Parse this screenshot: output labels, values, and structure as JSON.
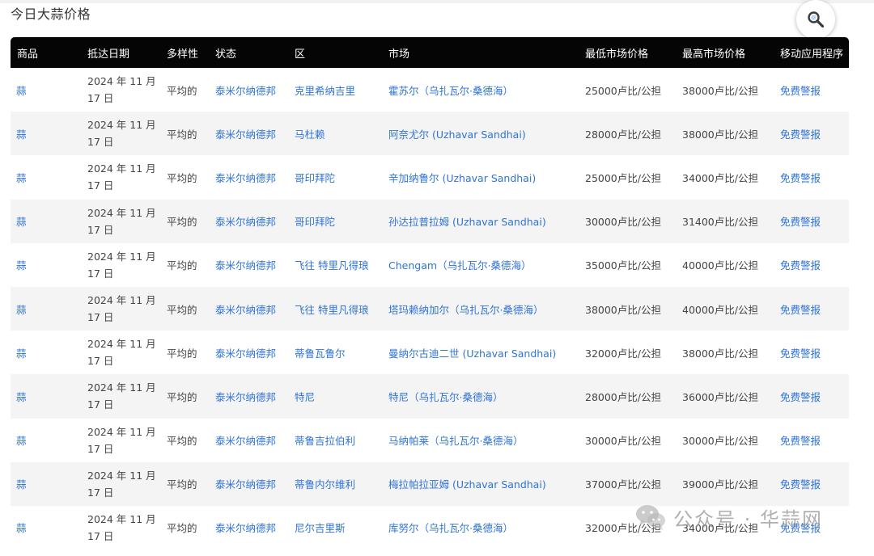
{
  "page": {
    "title": "今日大蒜价格",
    "search_icon": "search-icon"
  },
  "table": {
    "headers": [
      "商品",
      "抵达日期",
      "多样性",
      "状态",
      "区",
      "市场",
      "最低市场价格",
      "最高市场价格",
      "移动应用程序"
    ],
    "rows": [
      {
        "commodity": "蒜",
        "date": "2024 年 11 月 17 日",
        "variety": "平均的",
        "state": "泰米尔纳德邦",
        "district": "克里希纳吉里",
        "market": "霍苏尔（乌扎瓦尔·桑德海）",
        "min_price": "25000卢比/公担",
        "max_price": "38000卢比/公担",
        "app": "免费警报"
      },
      {
        "commodity": "蒜",
        "date": "2024 年 11 月 17 日",
        "variety": "平均的",
        "state": "泰米尔纳德邦",
        "district": "马杜赖",
        "market": "阿奈尤尔 (Uzhavar Sandhai)",
        "min_price": "28000卢比/公担",
        "max_price": "38000卢比/公担",
        "app": "免费警报"
      },
      {
        "commodity": "蒜",
        "date": "2024 年 11 月 17 日",
        "variety": "平均的",
        "state": "泰米尔纳德邦",
        "district": "哥印拜陀",
        "market": "辛加纳鲁尔 (Uzhavar Sandhai)",
        "min_price": "25000卢比/公担",
        "max_price": "34000卢比/公担",
        "app": "免费警报"
      },
      {
        "commodity": "蒜",
        "date": "2024 年 11 月 17 日",
        "variety": "平均的",
        "state": "泰米尔纳德邦",
        "district": "哥印拜陀",
        "market": "孙达拉普拉姆 (Uzhavar Sandhai)",
        "min_price": "30000卢比/公担",
        "max_price": "31400卢比/公担",
        "app": "免费警报"
      },
      {
        "commodity": "蒜",
        "date": "2024 年 11 月 17 日",
        "variety": "平均的",
        "state": "泰米尔纳德邦",
        "district": "飞往 特里凡得琅",
        "market": "Chengam（乌扎瓦尔·桑德海）",
        "min_price": "35000卢比/公担",
        "max_price": "40000卢比/公担",
        "app": "免费警报"
      },
      {
        "commodity": "蒜",
        "date": "2024 年 11 月 17 日",
        "variety": "平均的",
        "state": "泰米尔纳德邦",
        "district": "飞往 特里凡得琅",
        "market": "塔玛赖纳加尔（乌扎瓦尔·桑德海）",
        "min_price": "38000卢比/公担",
        "max_price": "40000卢比/公担",
        "app": "免费警报"
      },
      {
        "commodity": "蒜",
        "date": "2024 年 11 月 17 日",
        "variety": "平均的",
        "state": "泰米尔纳德邦",
        "district": "蒂鲁瓦鲁尔",
        "market": "曼纳尔古迪二世 (Uzhavar Sandhai)",
        "min_price": "32000卢比/公担",
        "max_price": "38000卢比/公担",
        "app": "免费警报"
      },
      {
        "commodity": "蒜",
        "date": "2024 年 11 月 17 日",
        "variety": "平均的",
        "state": "泰米尔纳德邦",
        "district": "特尼",
        "market": "特尼（乌扎瓦尔·桑德海）",
        "min_price": "28000卢比/公担",
        "max_price": "36000卢比/公担",
        "app": "免费警报"
      },
      {
        "commodity": "蒜",
        "date": "2024 年 11 月 17 日",
        "variety": "平均的",
        "state": "泰米尔纳德邦",
        "district": "蒂鲁吉拉伯利",
        "market": "马纳帕莱（乌扎瓦尔·桑德海）",
        "min_price": "30000卢比/公担",
        "max_price": "30000卢比/公担",
        "app": "免费警报"
      },
      {
        "commodity": "蒜",
        "date": "2024 年 11 月 17 日",
        "variety": "平均的",
        "state": "泰米尔纳德邦",
        "district": "蒂鲁内尔维利",
        "market": "梅拉帕拉亚姆 (Uzhavar Sandhai)",
        "min_price": "37000卢比/公担",
        "max_price": "39000卢比/公担",
        "app": "免费警报"
      },
      {
        "commodity": "蒜",
        "date": "2024 年 11 月 17 日",
        "variety": "平均的",
        "state": "泰米尔纳德邦",
        "district": "尼尔吉里斯",
        "market": "库努尔（乌扎瓦尔·桑德海）",
        "min_price": "32000卢比/公担",
        "max_price": "34000卢比/公担",
        "app": "免费警报"
      }
    ]
  },
  "watermark": {
    "text": "公众号 · 华蒜网",
    "icon": "wechat-icon"
  },
  "colors": {
    "link": "#2f73d7",
    "header_bg": "#050505",
    "row_alt": "#f4f4f4"
  }
}
